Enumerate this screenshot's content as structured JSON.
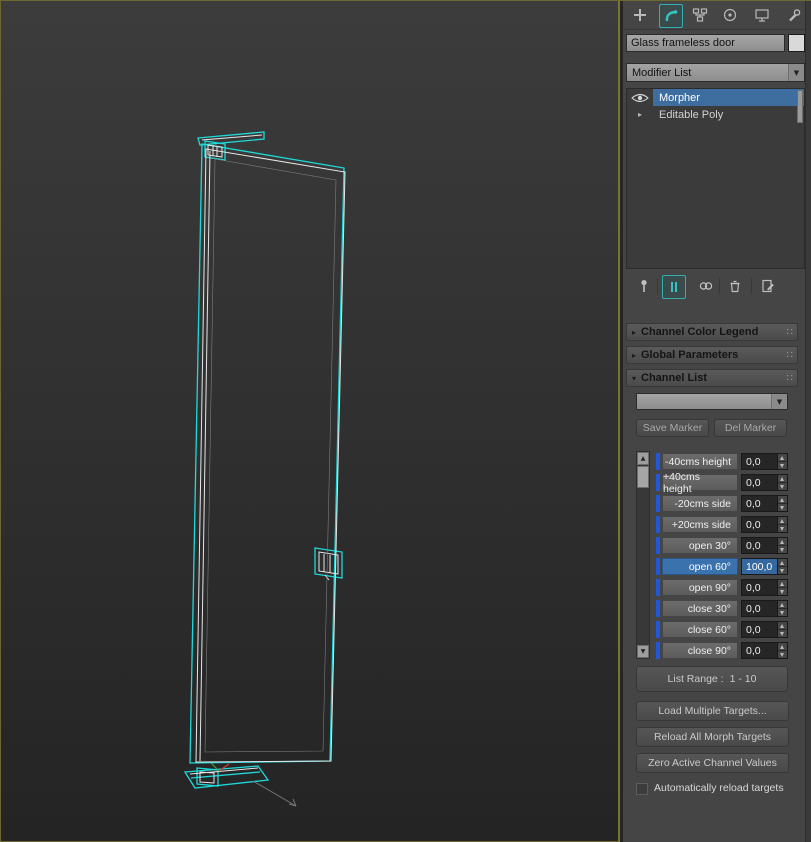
{
  "object": {
    "name": "Glass frameless  door",
    "wire_color": "#d9d9d9"
  },
  "command_tabs": [
    {
      "name": "create"
    },
    {
      "name": "modify",
      "active": true
    },
    {
      "name": "hierarchy"
    },
    {
      "name": "motion"
    },
    {
      "name": "display"
    },
    {
      "name": "utilities"
    }
  ],
  "modifier_list_label": "Modifier List",
  "modifier_stack": [
    {
      "label": "Morpher",
      "selected": true,
      "icon": "eye-icon"
    },
    {
      "label": "Editable Poly",
      "selected": false,
      "icon": "expand-arrow-icon"
    }
  ],
  "stack_tools": [
    "pin-stack",
    "show-end-result",
    "make-unique",
    "remove-modifier",
    "configure-modifier-sets"
  ],
  "rollouts": {
    "color_legend": "Channel Color Legend",
    "global_params": "Global Parameters",
    "channel_list": "Channel List"
  },
  "markers": {
    "save": "Save Marker",
    "del": "Del Marker"
  },
  "channel_list": {
    "channels": [
      {
        "name": "-40cms height",
        "value": "0,0",
        "selected": false
      },
      {
        "name": "+40cms height",
        "value": "0,0",
        "selected": false
      },
      {
        "name": "-20cms side",
        "value": "0,0",
        "selected": false
      },
      {
        "name": "+20cms side",
        "value": "0,0",
        "selected": false
      },
      {
        "name": "open 30°",
        "value": "0,0",
        "selected": false
      },
      {
        "name": "open 60°",
        "value": "100,0",
        "selected": true
      },
      {
        "name": "open 90°",
        "value": "0,0",
        "selected": false
      },
      {
        "name": "close 30°",
        "value": "0,0",
        "selected": false
      },
      {
        "name": "close 60°",
        "value": "0,0",
        "selected": false
      },
      {
        "name": "close 90°",
        "value": "0,0",
        "selected": false
      }
    ],
    "list_range_label": "List Range :",
    "list_range_value": "1 - 10",
    "load_multiple": "Load Multiple Targets...",
    "reload_all": "Reload All Morph Targets",
    "zero_active": "Zero Active Channel Values",
    "auto_reload": "Automatically reload targets"
  },
  "colors": {
    "selection_blue": "#3e6da0",
    "channel_bar_blue": "#2257d8",
    "active_teal": "#2fb0b0",
    "wireframe_cyan": "#1fd9d9",
    "viewport_border_olive": "#7a7433"
  },
  "glyphs": {
    "collapsed": "▸",
    "expanded": "▾",
    "dropdown": "▼",
    "grip": "∷",
    "up": "▲",
    "down": "▼"
  }
}
